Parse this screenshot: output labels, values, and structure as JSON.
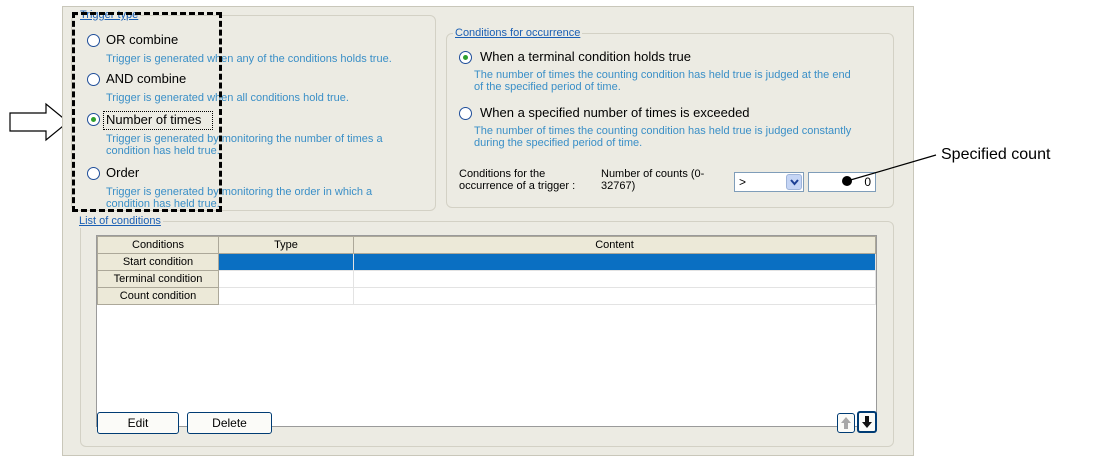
{
  "trigger_type": {
    "legend": "Trigger type",
    "options": [
      {
        "label": "OR combine",
        "description": "Trigger is generated when any of the conditions holds true.",
        "checked": false
      },
      {
        "label": "AND combine",
        "description": "Trigger is generated when all conditions hold true.",
        "checked": false
      },
      {
        "label": "Number of times",
        "description": "Trigger is generated by monitoring the number of times a condition has held true.",
        "checked": true
      },
      {
        "label": "Order",
        "description": "Trigger is generated by monitoring the order in which a condition has held true.",
        "checked": false
      }
    ]
  },
  "occurrence": {
    "legend": "Conditions for occurrence",
    "options": [
      {
        "label": "When a terminal condition holds true",
        "description": "The number of times the counting condition has held true is judged at the end of the specified period of time.",
        "checked": true
      },
      {
        "label": "When a specified number of times is exceeded",
        "description": "The number of times the counting condition has held true is judged constantly during the specified period of time.",
        "checked": false
      }
    ],
    "trigger_label": "Conditions for the occurrence of a trigger :",
    "count_label": "Number of counts (0-32767)",
    "operator": ">",
    "count_value": "0"
  },
  "conditions": {
    "legend": "List of conditions",
    "columns": [
      "Conditions",
      "Type",
      "Content"
    ],
    "rows": [
      "Start condition",
      "Terminal condition",
      "Count condition"
    ],
    "edit_label": "Edit",
    "delete_label": "Delete"
  },
  "annotation": {
    "specified_count": "Specified count"
  }
}
